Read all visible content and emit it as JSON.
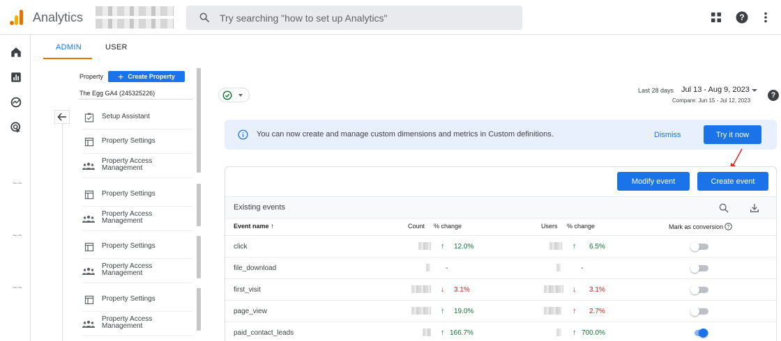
{
  "app": {
    "title": "Analytics"
  },
  "search": {
    "placeholder": "Try searching \"how to set up Analytics\""
  },
  "top_icons": [
    "apps-grid-icon",
    "help-icon",
    "more-vert-icon"
  ],
  "rail": {
    "icons": [
      "home-icon",
      "reports-icon",
      "explore-icon",
      "advertising-icon"
    ]
  },
  "tabs": [
    {
      "label": "ADMIN",
      "active": true
    },
    {
      "label": "USER",
      "active": false
    }
  ],
  "property": {
    "label": "Property",
    "create_label": "Create Property",
    "name": "The Egg GA4 (245325226)"
  },
  "menu": [
    {
      "label": "Setup Assistant",
      "icon": "checklist-icon"
    },
    {
      "label": "Property Settings",
      "icon": "settings-panel-icon"
    },
    {
      "label": "Property Access Management",
      "line1": "Property Access",
      "line2": "Management",
      "icon": "people-icon"
    },
    {
      "label": "Property Settings",
      "icon": "settings-panel-icon"
    },
    {
      "label": "Property Access Management",
      "line1": "Property Access",
      "line2": "Management",
      "icon": "people-icon"
    },
    {
      "label": "Property Settings",
      "icon": "settings-panel-icon"
    },
    {
      "label": "Property Access Management",
      "line1": "Property Access",
      "line2": "Management",
      "icon": "people-icon"
    },
    {
      "label": "Property Settings",
      "icon": "settings-panel-icon"
    },
    {
      "label": "Property Access Management",
      "line1": "Property Access",
      "line2": "Management",
      "icon": "people-icon"
    }
  ],
  "header": {
    "date_label": "Last 28 days",
    "date_range": "Jul 13 - Aug 9, 2023",
    "compare": "Compare: Jun 15 - Jul 12, 2023"
  },
  "banner": {
    "message": "You can now create and manage custom dimensions and metrics in Custom definitions.",
    "dismiss": "Dismiss",
    "try": "Try it now"
  },
  "events": {
    "modify_label": "Modify event",
    "create_label": "Create event",
    "title": "Existing events",
    "columns": {
      "name": "Event name",
      "count": "Count",
      "count_change": "% change",
      "users": "Users",
      "users_change": "% change",
      "conversion": "Mark as conversion"
    },
    "rows": [
      {
        "name": "click",
        "count_change": "12.0%",
        "count_dir": "up",
        "users_change": "6.5%",
        "users_dir": "up",
        "conversion": false
      },
      {
        "name": "file_download",
        "count_change": "-",
        "count_dir": "none",
        "users_change": "-",
        "users_dir": "none",
        "conversion": false
      },
      {
        "name": "first_visit",
        "count_change": "3.1%",
        "count_dir": "down",
        "users_change": "3.1%",
        "users_dir": "down",
        "conversion": false
      },
      {
        "name": "page_view",
        "count_change": "19.0%",
        "count_dir": "up",
        "users_change": "2.7%",
        "users_dir": "up-red",
        "conversion": false
      },
      {
        "name": "paid_contact_leads",
        "count_change": "166.7%",
        "count_dir": "up",
        "users_change": "700.0%",
        "users_dir": "up",
        "conversion": true
      }
    ]
  },
  "colors": {
    "primary": "#1a73e8",
    "accent": "#e37400",
    "increase": "#137333",
    "decrease": "#c5221f",
    "banner_bg": "#e8f0fe"
  }
}
